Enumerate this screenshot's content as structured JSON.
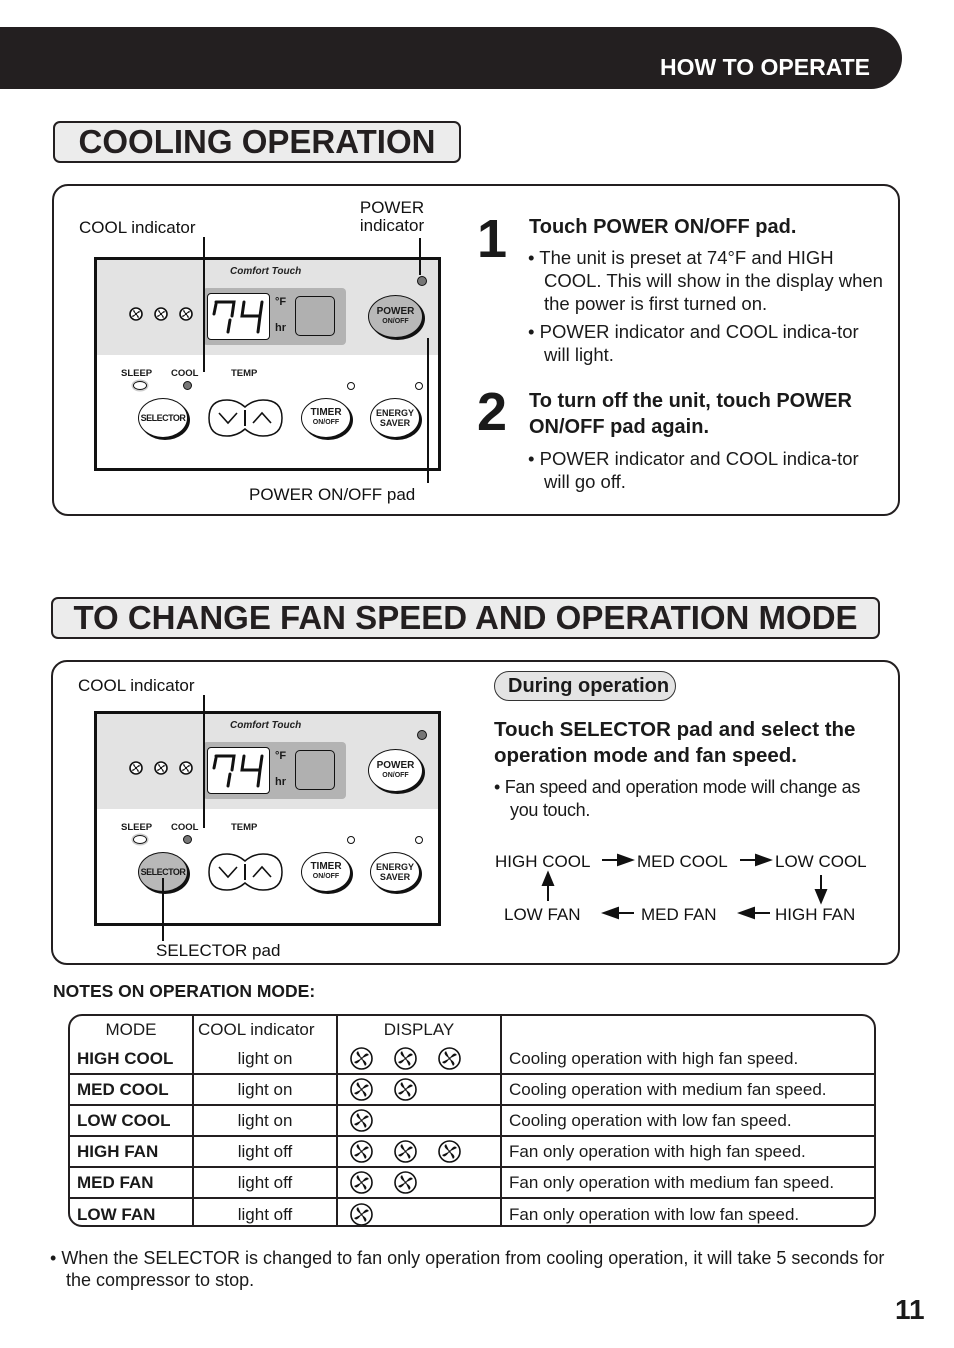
{
  "header": {
    "title": "HOW TO OPERATE"
  },
  "section1": {
    "title": "COOLING OPERATION",
    "callouts": {
      "cool_indicator": "COOL indicator",
      "power_indicator_1": "POWER",
      "power_indicator_2": "indicator",
      "power_pad": "POWER ON/OFF pad"
    },
    "panel": {
      "brand": "Comfort Touch",
      "temp": "74",
      "unit_f": "°F",
      "unit_hr": "hr",
      "power_a": "POWER",
      "power_b": "ON/OFF",
      "sleep": "SLEEP",
      "cool": "COOL",
      "temp_label": "TEMP",
      "selector": "SELECTOR",
      "timer_a": "TIMER",
      "timer_b": "ON/OFF",
      "energy_a": "ENERGY",
      "energy_b": "SAVER"
    },
    "steps": [
      {
        "num": "1",
        "heading": "Touch POWER ON/OFF pad.",
        "bullets": [
          "The unit is preset at 74°F and HIGH COOL.  This will show in the display when the power is first turned on.",
          "POWER indicator and COOL indica-tor will light."
        ]
      },
      {
        "num": "2",
        "heading": "To turn off the unit, touch POWER ON/OFF pad again.",
        "bullets": [
          "POWER indicator and COOL indica-tor will go off."
        ]
      }
    ]
  },
  "section2": {
    "title": "TO CHANGE FAN SPEED AND OPERATION MODE",
    "callouts": {
      "cool_indicator": "COOL indicator",
      "selector_pad": "SELECTOR pad"
    },
    "badge": "During operation",
    "heading": "Touch SELECTOR pad and select the operation mode and fan speed.",
    "bullet": "Fan speed and operation mode will change as you touch.",
    "flow": [
      "HIGH COOL",
      "MED COOL",
      "LOW COOL",
      "HIGH FAN",
      "MED FAN",
      "LOW FAN"
    ]
  },
  "notes": {
    "title": "NOTES ON OPERATION MODE:",
    "columns": [
      "MODE",
      "COOL indicator",
      "DISPLAY",
      ""
    ],
    "rows": [
      {
        "mode": "HIGH COOL",
        "indicator": "light on",
        "fans": 3,
        "desc": "Cooling operation with high fan speed."
      },
      {
        "mode": "MED COOL",
        "indicator": "light on",
        "fans": 2,
        "desc": "Cooling operation with medium fan speed."
      },
      {
        "mode": "LOW COOL",
        "indicator": "light on",
        "fans": 1,
        "desc": "Cooling operation with low fan speed."
      },
      {
        "mode": "HIGH FAN",
        "indicator": "light off",
        "fans": 3,
        "desc": "Fan only operation with high fan speed."
      },
      {
        "mode": "MED FAN",
        "indicator": "light off",
        "fans": 2,
        "desc": "Fan only operation with medium fan speed."
      },
      {
        "mode": "LOW FAN",
        "indicator": "light off",
        "fans": 1,
        "desc": "Fan only operation with low fan speed."
      }
    ],
    "footnote": "When the SELECTOR is changed to fan only operation from cooling  operation, it will take 5 seconds for the compressor to stop."
  },
  "page_number": "11"
}
